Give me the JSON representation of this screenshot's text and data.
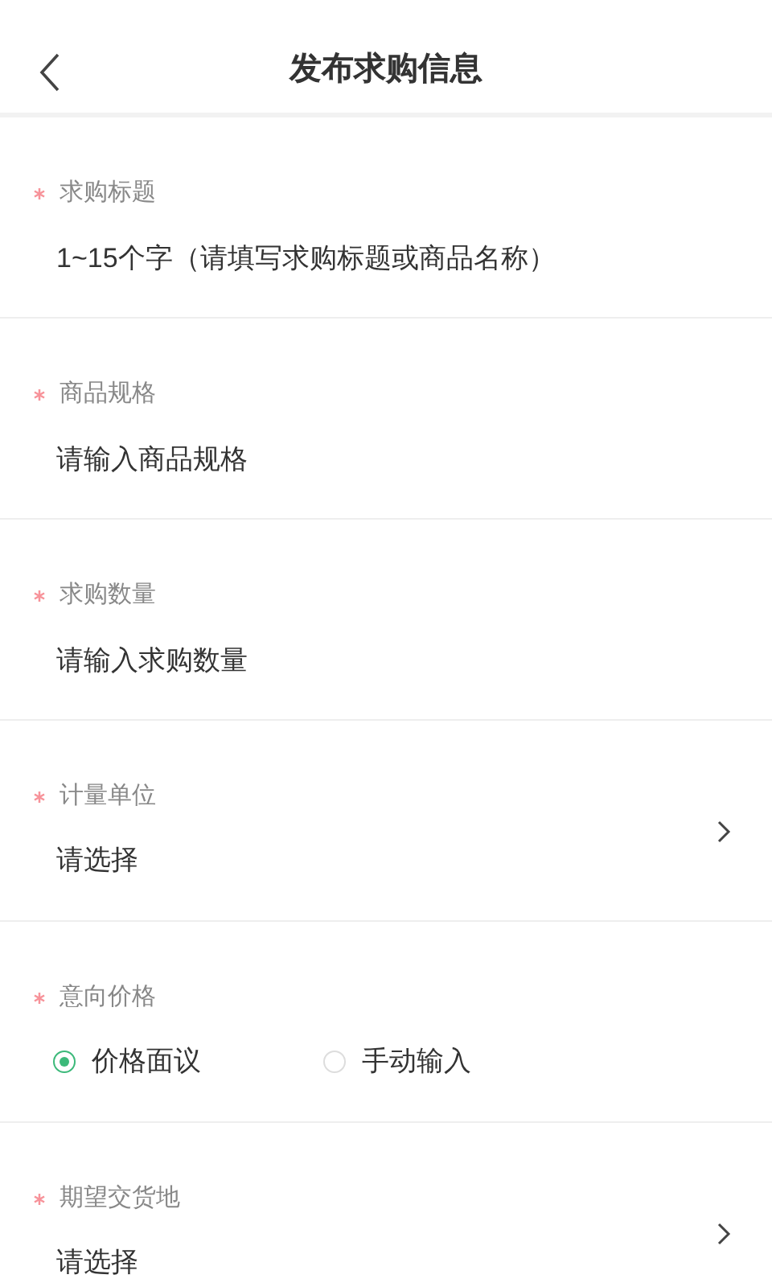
{
  "header": {
    "title": "发布求购信息"
  },
  "fields": [
    {
      "kind": "input",
      "label": "求购标题",
      "required": true,
      "placeholder": "1~15个字（请填写求购标题或商品名称）"
    },
    {
      "kind": "input",
      "label": "商品规格",
      "required": true,
      "placeholder": "请输入商品规格"
    },
    {
      "kind": "input",
      "label": "求购数量",
      "required": true,
      "placeholder": "请输入求购数量"
    },
    {
      "kind": "select",
      "label": "计量单位",
      "required": true,
      "value": "请选择"
    },
    {
      "kind": "radio",
      "label": "意向价格",
      "required": true,
      "options": [
        {
          "label": "价格面议",
          "selected": true
        },
        {
          "label": "手动输入",
          "selected": false
        }
      ]
    },
    {
      "kind": "select",
      "label": "期望交货地",
      "required": true,
      "value": "请选择"
    }
  ]
}
